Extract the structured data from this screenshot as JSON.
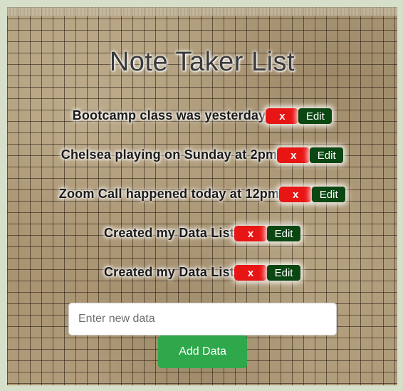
{
  "app": {
    "title": "Note Taker List"
  },
  "notes": [
    {
      "text": "Bootcamp class was yesterday",
      "delete_label": "x",
      "edit_label": "Edit"
    },
    {
      "text": "Chelsea playing on Sunday at 2pm",
      "delete_label": "x",
      "edit_label": "Edit"
    },
    {
      "text": "Zoom Call happened today at 12pm",
      "delete_label": "x",
      "edit_label": "Edit"
    },
    {
      "text": "Created my Data List",
      "delete_label": "x",
      "edit_label": "Edit"
    },
    {
      "text": "Created my Data List",
      "delete_label": "x",
      "edit_label": "Edit"
    }
  ],
  "form": {
    "input_value": "",
    "input_placeholder": "Enter new data",
    "add_label": "Add Data"
  },
  "colors": {
    "delete": "#e81515",
    "edit": "#0b4712",
    "add": "#2ea84a",
    "page_bg": "#d6dfca"
  }
}
